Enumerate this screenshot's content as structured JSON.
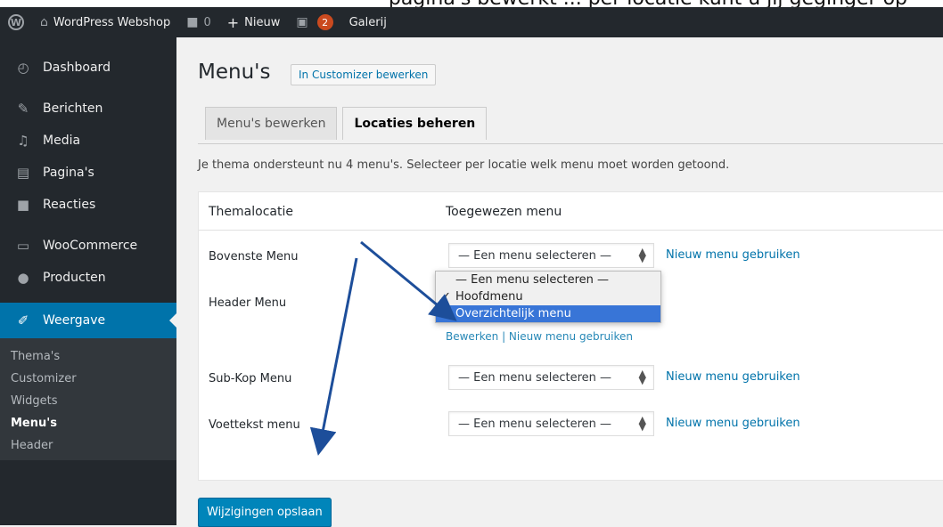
{
  "caption": {
    "text": "pagina's bewerkt ... per locatie kunt u jij geginger op"
  },
  "adminbar": {
    "site_name": "WordPress Webshop",
    "comments_count": "0",
    "new_label": "Nieuw",
    "updates_count": "2",
    "gallery_label": "Galerij"
  },
  "sidebar": {
    "items": [
      {
        "label": "Dashboard",
        "icon": "dashboard-icon"
      },
      {
        "label": "Berichten",
        "icon": "pin-icon"
      },
      {
        "label": "Media",
        "icon": "media-icon"
      },
      {
        "label": "Pagina's",
        "icon": "pages-icon"
      },
      {
        "label": "Reacties",
        "icon": "comments-icon"
      },
      {
        "label": "WooCommerce",
        "icon": "woocommerce-icon"
      },
      {
        "label": "Producten",
        "icon": "products-icon"
      },
      {
        "label": "Weergave",
        "icon": "brush-icon"
      }
    ],
    "submenu": [
      "Thema's",
      "Customizer",
      "Widgets",
      "Menu's",
      "Header"
    ]
  },
  "main": {
    "title": "Menu's",
    "customizer_button": "In Customizer bewerken",
    "tabs": [
      "Menu's bewerken",
      "Locaties beheren"
    ],
    "description": "Je thema ondersteunt nu 4 menu's. Selecteer per locatie welk menu moet worden getoond.",
    "table": {
      "col_location": "Themalocatie",
      "col_menu": "Toegewezen menu",
      "rows": [
        {
          "location": "Bovenste Menu",
          "select": "— Een menu selecteren —",
          "link": "Nieuw menu gebruiken"
        },
        {
          "location": "Header Menu"
        },
        {
          "location": "Sub-Kop Menu",
          "select": "— Een menu selecteren —",
          "link": "Nieuw menu gebruiken"
        },
        {
          "location": "Voettekst menu",
          "select": "— Een menu selecteren —",
          "link": "Nieuw menu gebruiken"
        }
      ],
      "header_menu_links_partial": "Bewerken | Nieuw menu gebruiken"
    },
    "dropdown": {
      "options": [
        "— Een menu selecteren —",
        "Hoofdmenu",
        "Overzichtelijk menu"
      ],
      "checked": "Hoofdmenu",
      "highlighted": "Overzichtelijk menu"
    },
    "save_button": "Wijzigingen opslaan"
  },
  "colors": {
    "adminbar_bg": "#23282d",
    "accent": "#0073aa",
    "button_primary": "#0085ba",
    "highlight": "#3875d7",
    "annotation_arrow": "#1d4e9a"
  }
}
